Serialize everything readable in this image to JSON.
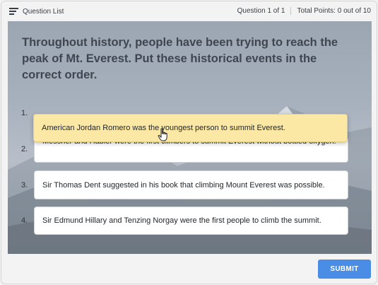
{
  "header": {
    "question_list_label": "Question List",
    "question_counter": "Question 1 of 1",
    "total_points": "Total Points: 0 out of 10"
  },
  "question": {
    "text": "Throughout history, people have been trying to reach the peak of Mt. Everest. Put these historical events in the correct order."
  },
  "items": [
    {
      "number": "1.",
      "text": "American Jordan Romero was the youngest person to summit Everest."
    },
    {
      "number": "2.",
      "text": "Messner and Habler were the first climbers to summit Everest without bottled oxygen."
    },
    {
      "number": "3.",
      "text": "Sir Thomas Dent suggested in his book that climbing Mount Everest was possible."
    },
    {
      "number": "4.",
      "text": "Sir Edmund Hillary and Tenzing Norgay were the first people to climb the summit."
    }
  ],
  "footer": {
    "submit_label": "SUBMIT"
  },
  "colors": {
    "submit": "#4a8de6",
    "dragged_card": "#fbe8a4"
  }
}
